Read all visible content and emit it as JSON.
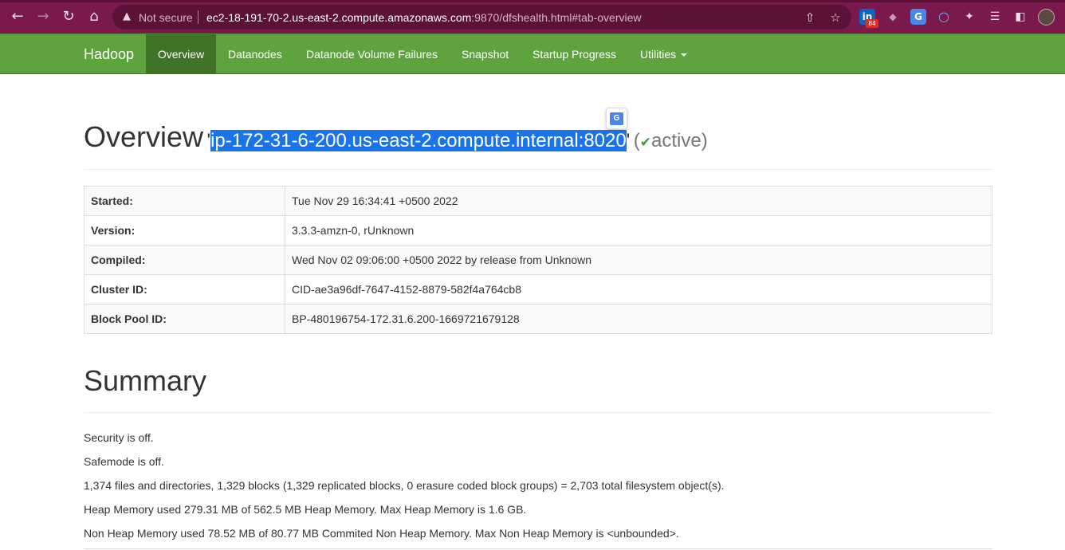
{
  "browser": {
    "security_label": "Not secure",
    "url_host": "ec2-18-191-70-2.us-east-2.compute.amazonaws.com",
    "url_path": ":9870/dfshealth.html#tab-overview",
    "extension_badge": "84",
    "colors": {
      "frame": "#7a1a4c",
      "omnibox": "#5c1238"
    }
  },
  "navbar": {
    "brand": "Hadoop",
    "items": [
      "Overview",
      "Datanodes",
      "Datanode Volume Failures",
      "Snapshot",
      "Startup Progress",
      "Utilities"
    ],
    "active": "Overview",
    "colors": {
      "bar": "#5fa33e",
      "active": "#3f7327"
    }
  },
  "overview": {
    "title": "Overview",
    "host": "ip-172-31-6-200.us-east-2.compute.internal:8020",
    "status": "active",
    "rows": [
      {
        "label": "Started:",
        "value": "Tue Nov 29 16:34:41 +0500 2022"
      },
      {
        "label": "Version:",
        "value": "3.3.3-amzn-0, rUnknown"
      },
      {
        "label": "Compiled:",
        "value": "Wed Nov 02 09:06:00 +0500 2022 by release from Unknown"
      },
      {
        "label": "Cluster ID:",
        "value": "CID-ae3a96df-7647-4152-8879-582f4a764cb8"
      },
      {
        "label": "Block Pool ID:",
        "value": "BP-480196754-172.31.6.200-1669721679128"
      }
    ]
  },
  "summary": {
    "title": "Summary",
    "lines": [
      "Security is off.",
      "Safemode is off.",
      "1,374 files and directories, 1,329 blocks (1,329 replicated blocks, 0 erasure coded block groups) = 2,703 total filesystem object(s).",
      "Heap Memory used 279.31 MB of 562.5 MB Heap Memory. Max Heap Memory is 1.6 GB.",
      "Non Heap Memory used 78.52 MB of 80.77 MB Commited Non Heap Memory. Max Non Heap Memory is <unbounded>."
    ]
  }
}
